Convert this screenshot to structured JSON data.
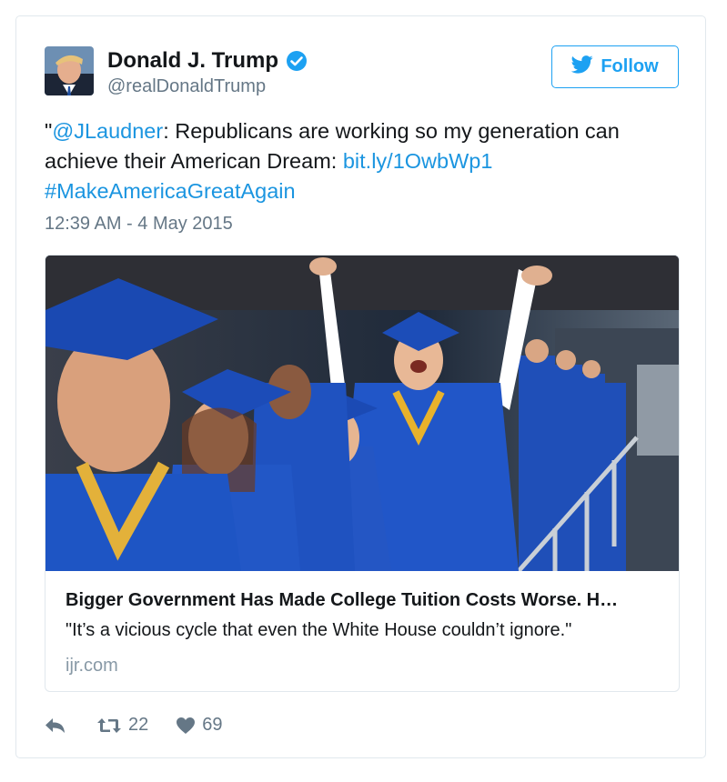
{
  "author": {
    "display_name": "Donald J. Trump",
    "handle": "@realDonaldTrump",
    "verified": true
  },
  "follow_button": {
    "label": "Follow",
    "icon": "twitter-bird-icon"
  },
  "tweet": {
    "open_quote": "\"",
    "mention": "@JLaudner",
    "text_part1": ": Republicans are working so my generation can achieve their American Dream: ",
    "link": "bit.ly/1OwbWp1",
    "hashtag": "#MakeAmericaGreatAgain",
    "timestamp": "12:39 AM - 4 May 2015"
  },
  "card": {
    "title": "Bigger Government Has Made College Tuition Costs Worse. H…",
    "description": "\"It’s a vicious cycle that even the White House couldn’t ignore.\"",
    "domain": "ijr.com",
    "image_icon": "graduation-photo"
  },
  "actions": {
    "reply_icon": "reply-icon",
    "retweet_icon": "retweet-icon",
    "retweet_count": "22",
    "like_icon": "heart-icon",
    "like_count": "69"
  },
  "colors": {
    "accent": "#1da1f2",
    "link": "#1b95e0",
    "muted": "#657786",
    "gown": "#1f56c0"
  }
}
